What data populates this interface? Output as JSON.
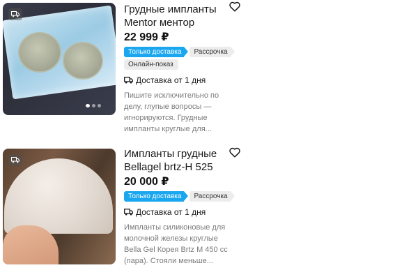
{
  "listings": [
    {
      "title": "Грудные импланты Mentor ментор",
      "price": "22 999 ₽",
      "tags": [
        "Только доставка",
        "Рассрочка",
        "Онлайн-показ"
      ],
      "delivery": "Доставка от 1 дня",
      "description": "Пишите исключительно по делу, глупые вопросы — игнорируются. Грудные импланты круглые для...",
      "photo_icons": [
        "truck-icon"
      ]
    },
    {
      "title": "Импланты грудные Bellagel brtz-H 525",
      "price": "20 000 ₽",
      "tags": [
        "Только доставка",
        "Рассрочка"
      ],
      "delivery": "Доставка от 1 дня",
      "description": "Импланты силиконовые для молочной железы круглые Bella Gel Корея Brtz M 450 cc (пара). Стояли меньше...",
      "photo_icons": [
        "truck-icon"
      ]
    }
  ],
  "colors": {
    "tag_delivery": "#1aa7f0",
    "tag_grey": "#ececec",
    "description_text": "#7a7a7a"
  }
}
